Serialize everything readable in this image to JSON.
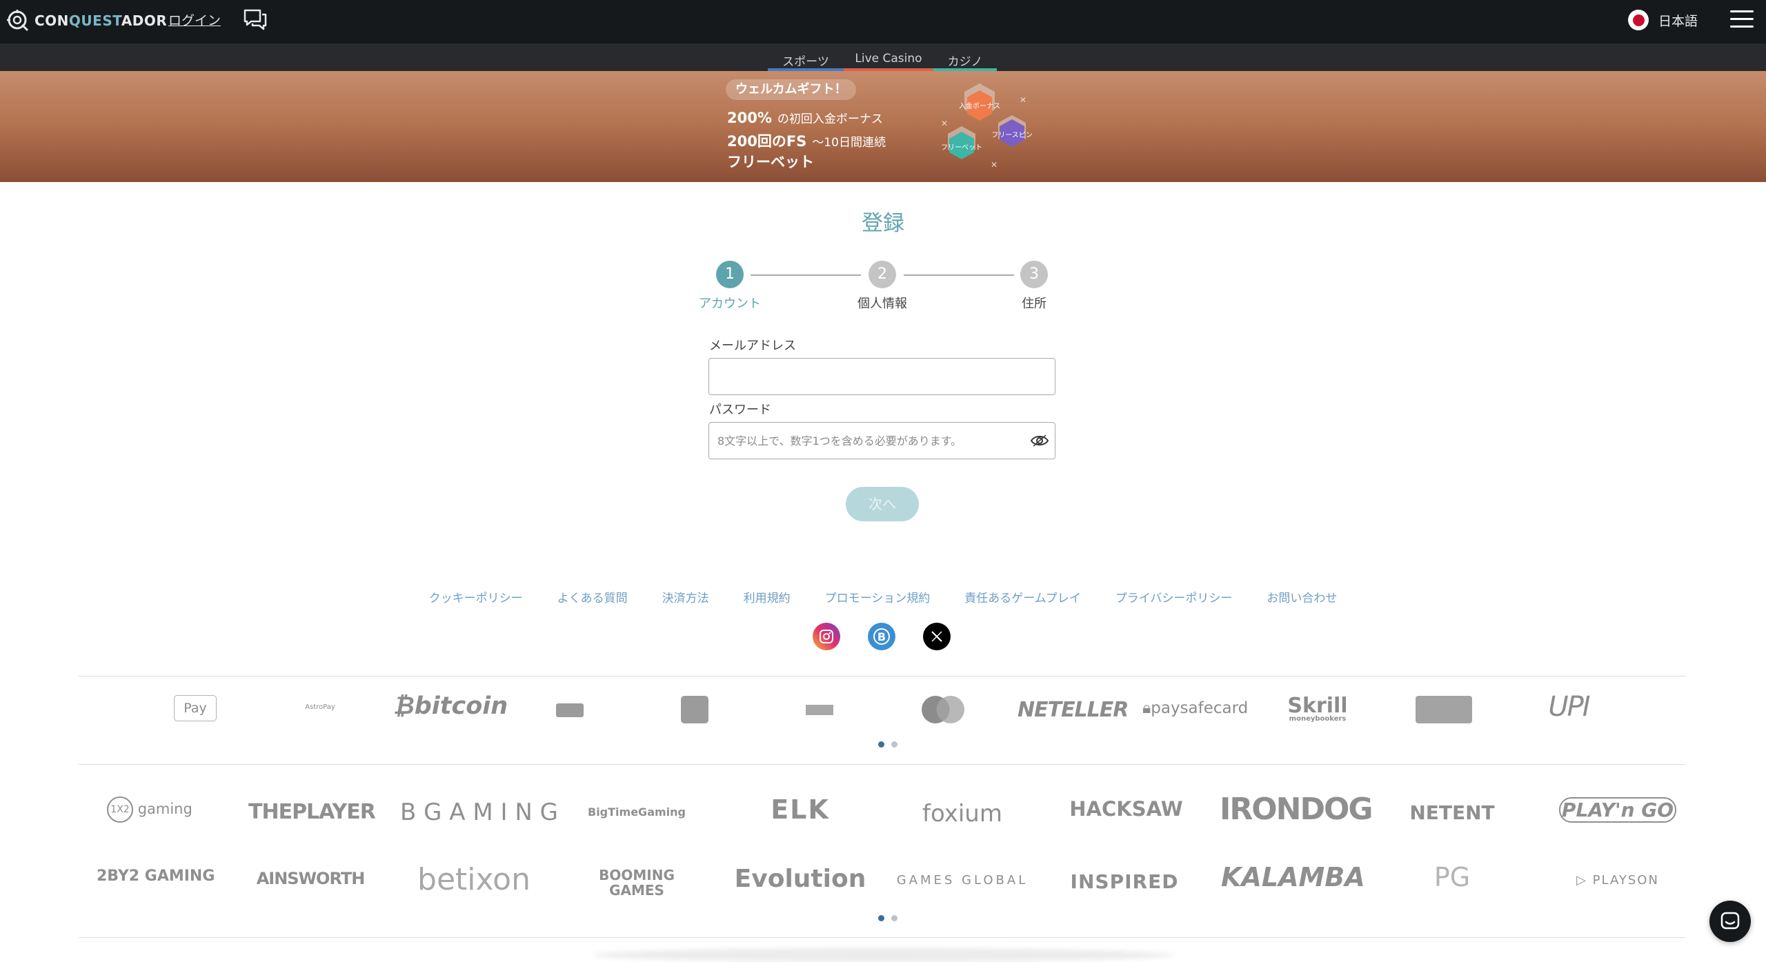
{
  "header": {
    "logo_prefix": "CON",
    "logo_accent": "QUEST",
    "logo_suffix": "ADOR",
    "login_label": "ログイン",
    "language_label": "日本語"
  },
  "subnav": {
    "tabs": [
      {
        "label": "スポーツ",
        "color": "#4a78c0"
      },
      {
        "label": "Live Casino",
        "color": "#e0604a"
      },
      {
        "label": "カジノ",
        "color": "#3fb5a8"
      }
    ]
  },
  "banner": {
    "badge": "ウェルカムギフト！",
    "line1_bold": "200%",
    "line1_small": "の初回入金ボーナス",
    "line2_bold": "200回のFS",
    "line2_small": "〜10日間連続",
    "line3_bold": "フリーベット",
    "hex_deposit": "入金ボーナス",
    "hex_freebet": "フリーベット",
    "hex_freespin": "フリースピン"
  },
  "registration": {
    "title": "登録",
    "steps": [
      {
        "number": "1",
        "label": "アカウント"
      },
      {
        "number": "2",
        "label": "個人情報"
      },
      {
        "number": "3",
        "label": "住所"
      }
    ],
    "email_label": "メールアドレス",
    "email_value": "",
    "password_label": "パスワード",
    "password_placeholder": "8文字以上で、数字1つを含める必要があります。",
    "next_label": "次へ"
  },
  "footer": {
    "links": [
      "クッキーポリシー",
      "よくある質問",
      "決済方法",
      "利用規約",
      "プロモーション規約",
      "責任あるゲームプレイ",
      "プライバシーポリシー",
      "お問い合わせ"
    ]
  },
  "payments": {
    "logos": [
      "Pay",
      "AstroPay",
      "bitcoin",
      "NETELLER",
      "paysafecard",
      "Skrill",
      "moneybookers",
      "UPI"
    ]
  },
  "providers": {
    "row1": [
      "gaming",
      "THEPLAYER",
      "B G A M I N G",
      "BigTimeGaming",
      "ELK",
      "foxium",
      "HACKSAW",
      "IRONDOG",
      "NETENT",
      "PLAY'n GO"
    ],
    "row2": [
      "2BY2 GAMING",
      "AINSWORTH",
      "betixon",
      "BOOMING GAMES",
      "Evolution",
      "GAMES GLOBAL",
      "INSPIRED",
      "KALAMBA",
      "PG",
      "PLAYSON"
    ]
  },
  "colors": {
    "accent_teal": "#5fa4ad",
    "step_inactive": "#c4c4c4",
    "link_blue": "#6f9fc4"
  }
}
